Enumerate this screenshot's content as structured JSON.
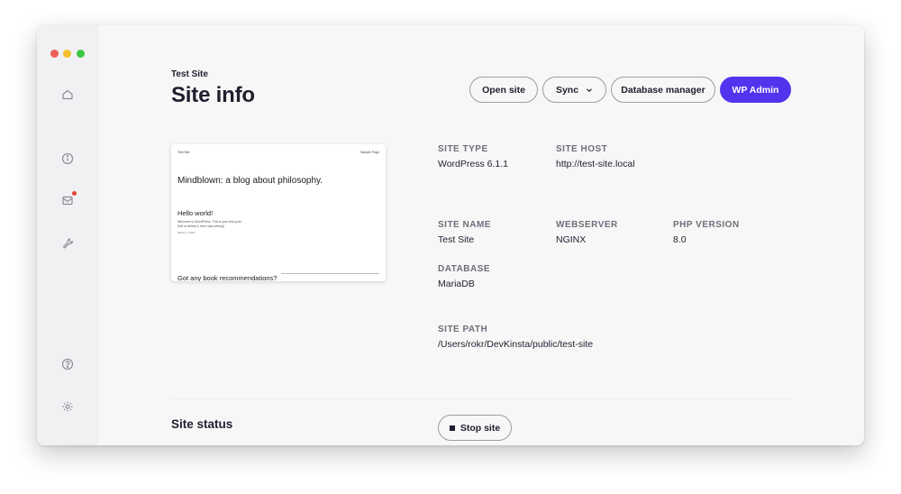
{
  "window": {
    "controls": {
      "close": "close",
      "minimize": "minimize",
      "zoom": "zoom"
    }
  },
  "sidebar": {
    "items": [
      {
        "name": "home",
        "icon": "home-icon"
      },
      {
        "name": "site-info",
        "icon": "info-icon"
      },
      {
        "name": "email",
        "icon": "mail-icon",
        "has_notification": true
      },
      {
        "name": "tools",
        "icon": "wrench-icon"
      },
      {
        "name": "help",
        "icon": "help-icon"
      },
      {
        "name": "settings",
        "icon": "gear-icon"
      }
    ]
  },
  "header": {
    "breadcrumb": "Test Site",
    "title": "Site info"
  },
  "toolbar": {
    "open_site": "Open site",
    "sync": "Sync",
    "database_manager": "Database manager",
    "wp_admin": "WP Admin"
  },
  "preview": {
    "site_name": "Test Site",
    "sample_page": "Sample Page",
    "tagline": "Mindblown: a blog about philosophy.",
    "post_title": "Hello world!",
    "post_text_line1": "Welcome to WordPress. This is your first post.",
    "post_text_line2": "Edit or delete it, then start writing!",
    "post_date": "March 1, 2023",
    "bottom_question": "Got any book recommendations?"
  },
  "info": {
    "site_type": {
      "label": "SITE TYPE",
      "value": "WordPress 6.1.1"
    },
    "site_host": {
      "label": "SITE HOST",
      "value": "http://test-site.local"
    },
    "site_name": {
      "label": "SITE NAME",
      "value": "Test Site"
    },
    "webserver": {
      "label": "WEBSERVER",
      "value": "NGINX"
    },
    "php_version": {
      "label": "PHP VERSION",
      "value": "8.0"
    },
    "database": {
      "label": "DATABASE",
      "value": "MariaDB"
    },
    "site_path": {
      "label": "SITE PATH",
      "value": "/Users/rokr/DevKinsta/public/test-site"
    }
  },
  "status": {
    "title": "Site status",
    "stop_label": "Stop site"
  },
  "colors": {
    "accent": "#5333ed",
    "notification": "#e64236",
    "traffic_red": "#ee5f57",
    "traffic_yellow": "#f5be2f",
    "traffic_green": "#3dc644"
  }
}
